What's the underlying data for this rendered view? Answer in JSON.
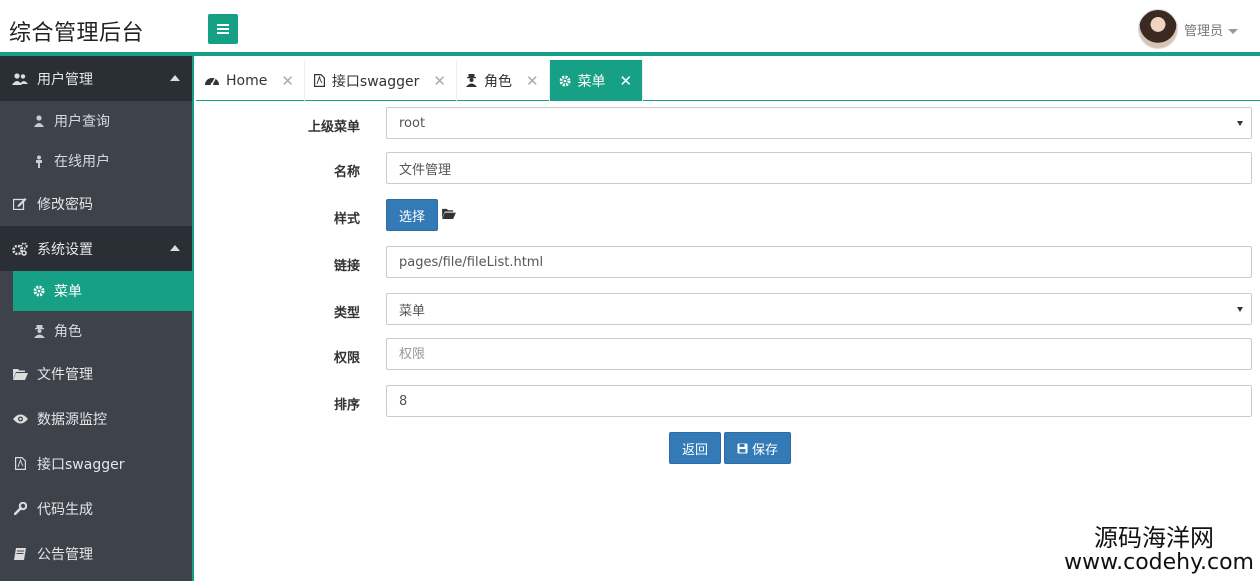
{
  "header": {
    "title": "综合管理后台",
    "user_name": "管理员"
  },
  "sidebar": {
    "items": [
      {
        "label": "用户管理",
        "icon": "users-icon",
        "expanded": true,
        "children": [
          {
            "label": "用户查询",
            "icon": "user-icon"
          },
          {
            "label": "在线用户",
            "icon": "online-user-icon"
          }
        ]
      },
      {
        "label": "修改密码",
        "icon": "edit-icon"
      },
      {
        "label": "系统设置",
        "icon": "cogs-icon",
        "expanded": true,
        "children": [
          {
            "label": "菜单",
            "icon": "gear-icon",
            "active": true
          },
          {
            "label": "角色",
            "icon": "user-secret-icon"
          }
        ]
      },
      {
        "label": "文件管理",
        "icon": "folder-open-icon"
      },
      {
        "label": "数据源监控",
        "icon": "eye-icon"
      },
      {
        "label": "接口swagger",
        "icon": "file-pdf-icon"
      },
      {
        "label": "代码生成",
        "icon": "wrench-icon"
      },
      {
        "label": "公告管理",
        "icon": "book-icon"
      }
    ]
  },
  "tabs": [
    {
      "label": "Home",
      "icon": "dashboard-icon"
    },
    {
      "label": "接口swagger",
      "icon": "file-pdf-icon"
    },
    {
      "label": "角色",
      "icon": "user-secret-icon"
    },
    {
      "label": "菜单",
      "icon": "gear-icon",
      "active": true
    }
  ],
  "form": {
    "parent_label": "上级菜单",
    "parent_value": "root",
    "name_label": "名称",
    "name_value": "文件管理",
    "style_label": "样式",
    "choose_button": "选择",
    "link_label": "链接",
    "link_value": "pages/file/fileList.html",
    "type_label": "类型",
    "type_value": "菜单",
    "perm_label": "权限",
    "perm_placeholder": "权限",
    "sort_label": "排序",
    "sort_value": "8",
    "back_button": "返回",
    "save_button": "保存"
  },
  "watermark": {
    "line1": "源码海洋网",
    "line2": "www.codehy.com"
  },
  "colors": {
    "accent": "#16a085",
    "sidebar_bg": "#3d424b",
    "sidebar_group_bg": "#2a2e35",
    "primary_button": "#337ab7"
  }
}
